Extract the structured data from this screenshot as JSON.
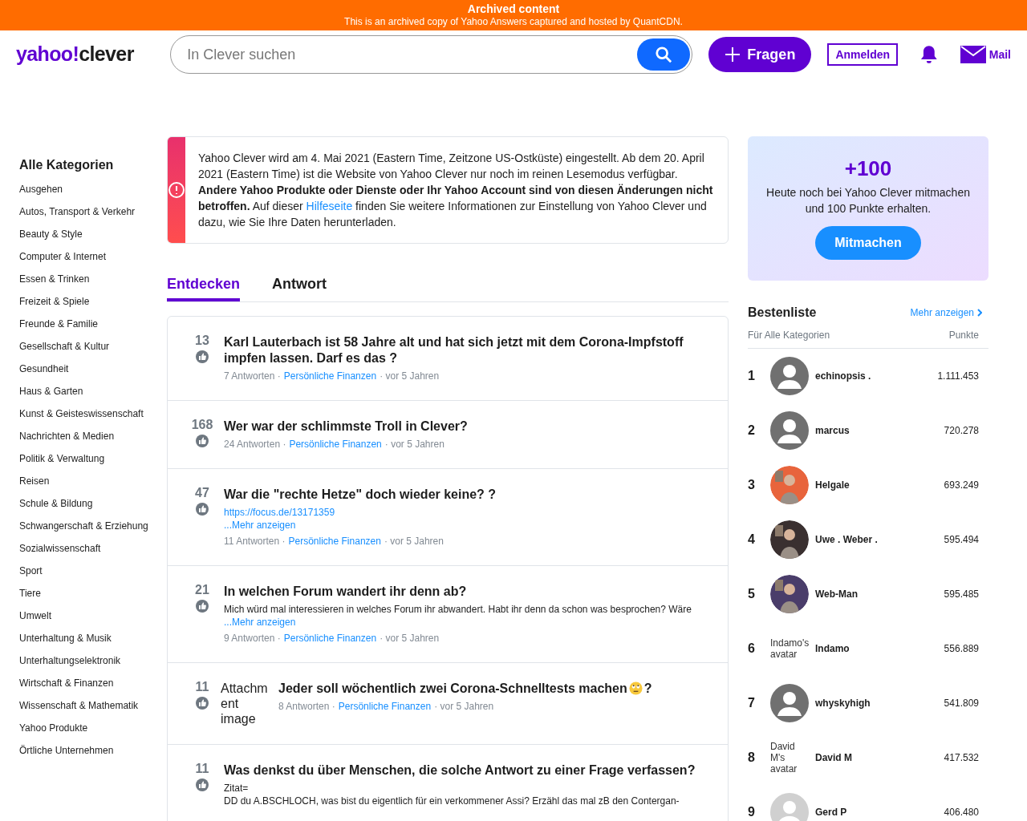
{
  "archive_banner": {
    "title": "Archived content",
    "subtitle": "This is an archived copy of Yahoo Answers captured and hosted by QuantCDN."
  },
  "header": {
    "logo_left": "yahoo!",
    "logo_right": "clever",
    "search": {
      "placeholder": "In Clever suchen"
    },
    "ask_button": "Fragen",
    "login_button": "Anmelden",
    "mail": "Mail"
  },
  "sidebar": {
    "title": "Alle Kategorien",
    "items": [
      "Ausgehen",
      "Autos, Transport & Verkehr",
      "Beauty & Style",
      "Computer & Internet",
      "Essen & Trinken",
      "Freizeit & Spiele",
      "Freunde & Familie",
      "Gesellschaft & Kultur",
      "Gesundheit",
      "Haus & Garten",
      "Kunst & Geisteswissenschaft",
      "Nachrichten & Medien",
      "Politik & Verwaltung",
      "Reisen",
      "Schule & Bildung",
      "Schwangerschaft & Erziehung",
      "Sozialwissenschaft",
      "Sport",
      "Tiere",
      "Umwelt",
      "Unterhaltung & Musik",
      "Unterhaltungselektronik",
      "Wirtschaft & Finanzen",
      "Wissenschaft & Mathematik",
      "Yahoo Produkte",
      "Örtliche Unternehmen"
    ]
  },
  "notice": {
    "text_before": "Yahoo Clever wird am 4. Mai 2021 (Eastern Time, Zeitzone US-Ostküste) eingestellt. Ab dem 20. April 2021 (Eastern Time) ist die Website von Yahoo Clever nur noch im reinen Lesemodus verfügbar. **Andere Yahoo Produkte oder Dienste oder Ihr Yahoo Account sind von diesen Änderungen nicht betroffen.** Auf dieser",
    "link": "Hilfeseite",
    "text_after": "finden Sie weitere Informationen zur Einstellung von Yahoo Clever und dazu, wie Sie Ihre Daten herunterladen."
  },
  "tabs": [
    {
      "label": "Entdecken",
      "selected": true
    },
    {
      "label": "Antwort",
      "selected": false
    }
  ],
  "questions": [
    {
      "votes": "13",
      "title": "Karl Lauterbach ist 58 Jahre alt und hat sich jetzt mit dem Corona-Impfstoff impfen lassen. Darf es das ?",
      "answers": "7 Antworten ·",
      "category": "Persönliche Finanzen",
      "time": "· vor 5 Jahren"
    },
    {
      "votes": "168",
      "title": "Wer war der schlimmste Troll in Clever?",
      "answers": "24 Antworten ·",
      "category": "Persönliche Finanzen",
      "time": "· vor 5 Jahren"
    },
    {
      "votes": "47",
      "title": "War die \"rechte Hetze\" doch wieder keine? ?",
      "link": "https://focus.de/13171359",
      "more": "...Mehr anzeigen",
      "answers": "11 Antworten ·",
      "category": "Persönliche Finanzen",
      "time": "· vor 5 Jahren"
    },
    {
      "votes": "21",
      "title": "In welchen Forum wandert ihr denn ab?",
      "body": "Mich würd mal interessieren in welches Forum ihr abwandert. Habt ihr denn da schon was besprochen? Wäre",
      "more": "...Mehr anzeigen",
      "answers": "9 Antworten ·",
      "category": "Persönliche Finanzen",
      "time": "· vor 5 Jahren"
    },
    {
      "votes": "11",
      "attachment_alt": "Attachment image",
      "title": "Jeder soll wöchentlich zwei Corona-Schnelltests machen",
      "emoji": true,
      "title_tail": "?",
      "answers": "8 Antworten ·",
      "category": "Persönliche Finanzen",
      "time": "· vor 5 Jahren"
    },
    {
      "votes": "11",
      "title": "Was denkst du über Menschen, die solche Antwort zu einer Frage verfassen?",
      "body": "Zitat=",
      "body_2": "DD du A.BSCHLOCH, was bist du eigentlich für ein verkommener Assi? Erzähl das mal zB den Contergan-"
    }
  ],
  "promo": {
    "points": "+100",
    "text": "Heute noch bei Yahoo Clever mitmachen und 100 Punkte erhalten.",
    "button": "Mitmachen"
  },
  "leaderboard": {
    "title": "Bestenliste",
    "more": "Mehr anzeigen",
    "col_left": "Für Alle Kategorien",
    "col_right": "Punkte",
    "rows": [
      {
        "rank": "1",
        "kind": "default",
        "name": "echinopsis .",
        "points": "1.111.453"
      },
      {
        "rank": "2",
        "kind": "default",
        "name": "marcus",
        "points": "720.278"
      },
      {
        "rank": "3",
        "name": "Helgale",
        "points": "693.249",
        "color": "#e8643c"
      },
      {
        "rank": "4",
        "name": "Uwe . Weber .",
        "points": "595.494",
        "color": "#3a3030"
      },
      {
        "rank": "5",
        "name": "Web-Man",
        "points": "595.485",
        "color": "#4a3d6a"
      },
      {
        "rank": "6",
        "kind": "alt",
        "avatar_alt": "Indamo's avatar",
        "name": "Indamo",
        "points": "556.889"
      },
      {
        "rank": "7",
        "kind": "default",
        "name": "whyskyhigh",
        "points": "541.809"
      },
      {
        "rank": "8",
        "kind": "alt",
        "avatar_alt": "David M's avatar",
        "name": "David M",
        "points": "417.532"
      },
      {
        "rank": "9",
        "kind": "light",
        "name": "Gerd P",
        "points": "406.480"
      }
    ]
  }
}
